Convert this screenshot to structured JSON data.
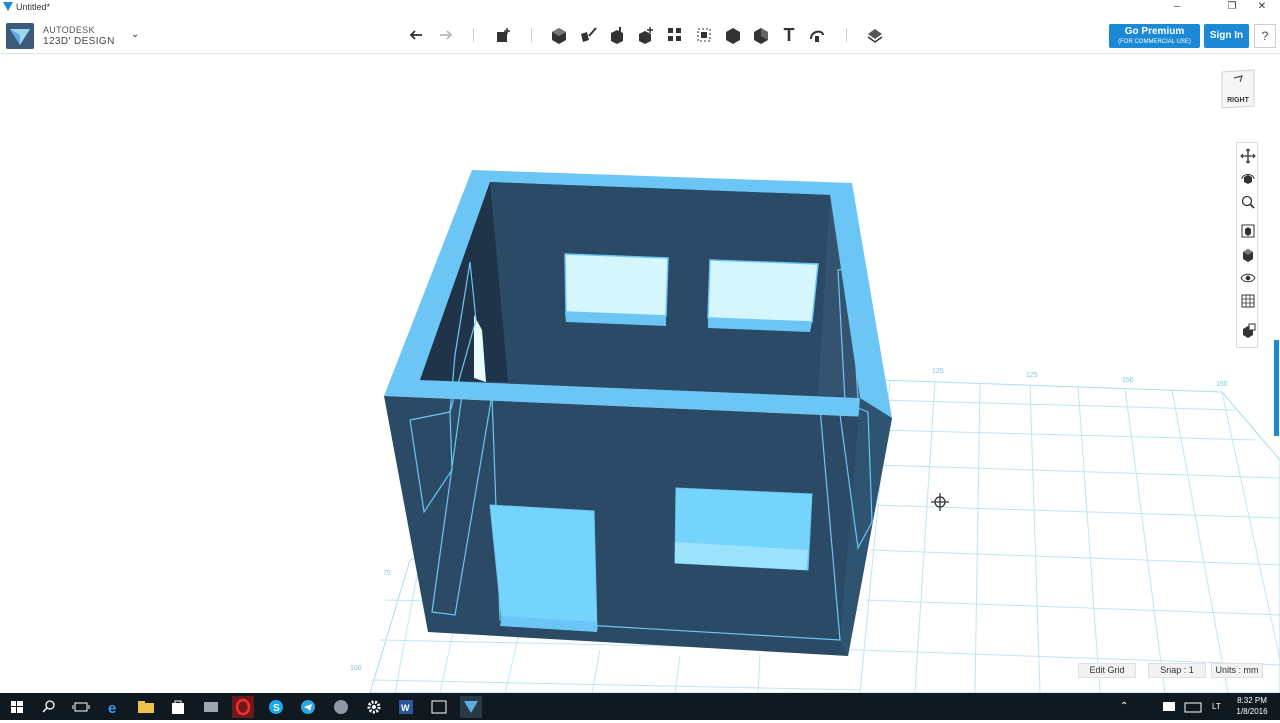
{
  "window": {
    "title": "Untitled*",
    "minimize": "–",
    "maximize": "❐",
    "close": "✕"
  },
  "brand": {
    "line1": "AUTODESK",
    "line2": "123D' DESIGN",
    "menu_chevron": "⌄"
  },
  "toolbar": {
    "tools": [
      {
        "name": "undo-icon"
      },
      {
        "name": "redo-icon"
      },
      {
        "name": "transform-icon"
      },
      {
        "name": "primitives-icon"
      },
      {
        "name": "sketch-icon"
      },
      {
        "name": "construct-icon"
      },
      {
        "name": "modify-icon"
      },
      {
        "name": "pattern-icon"
      },
      {
        "name": "grouping-icon"
      },
      {
        "name": "combine-icon"
      },
      {
        "name": "measure-icon"
      },
      {
        "name": "text-icon"
      },
      {
        "name": "snap-icon"
      },
      {
        "name": "material-icon"
      }
    ],
    "text_tool": "T"
  },
  "account": {
    "premium_title": "Go Premium",
    "premium_sub": "(FOR COMMERCIAL USE)",
    "signin": "Sign In",
    "help": "?"
  },
  "viewcube": {
    "face": "RIGHT"
  },
  "navigation": {
    "buttons": [
      "pan-icon",
      "orbit-icon",
      "zoom-icon",
      "fit-icon",
      "view-mode-icon",
      "visibility-icon",
      "grid-toggle-icon",
      "material-icon"
    ]
  },
  "grid": {
    "labels": [
      "125",
      "125",
      "150",
      "150",
      "75",
      "100"
    ]
  },
  "status": {
    "edit_grid": "Edit Grid",
    "snap_label": "Snap :",
    "snap_value": "1",
    "units": "Units : mm"
  },
  "taskbar": {
    "lang": "LT",
    "time": "8:32 PM",
    "date": "1/8/2016",
    "up_arrow": "⌃"
  },
  "colors": {
    "accent": "#1c89d6",
    "model_face": "#2b4a66",
    "model_rim": "#6cc6f5",
    "grid": "#a9dcf2",
    "taskbar": "#101820"
  }
}
